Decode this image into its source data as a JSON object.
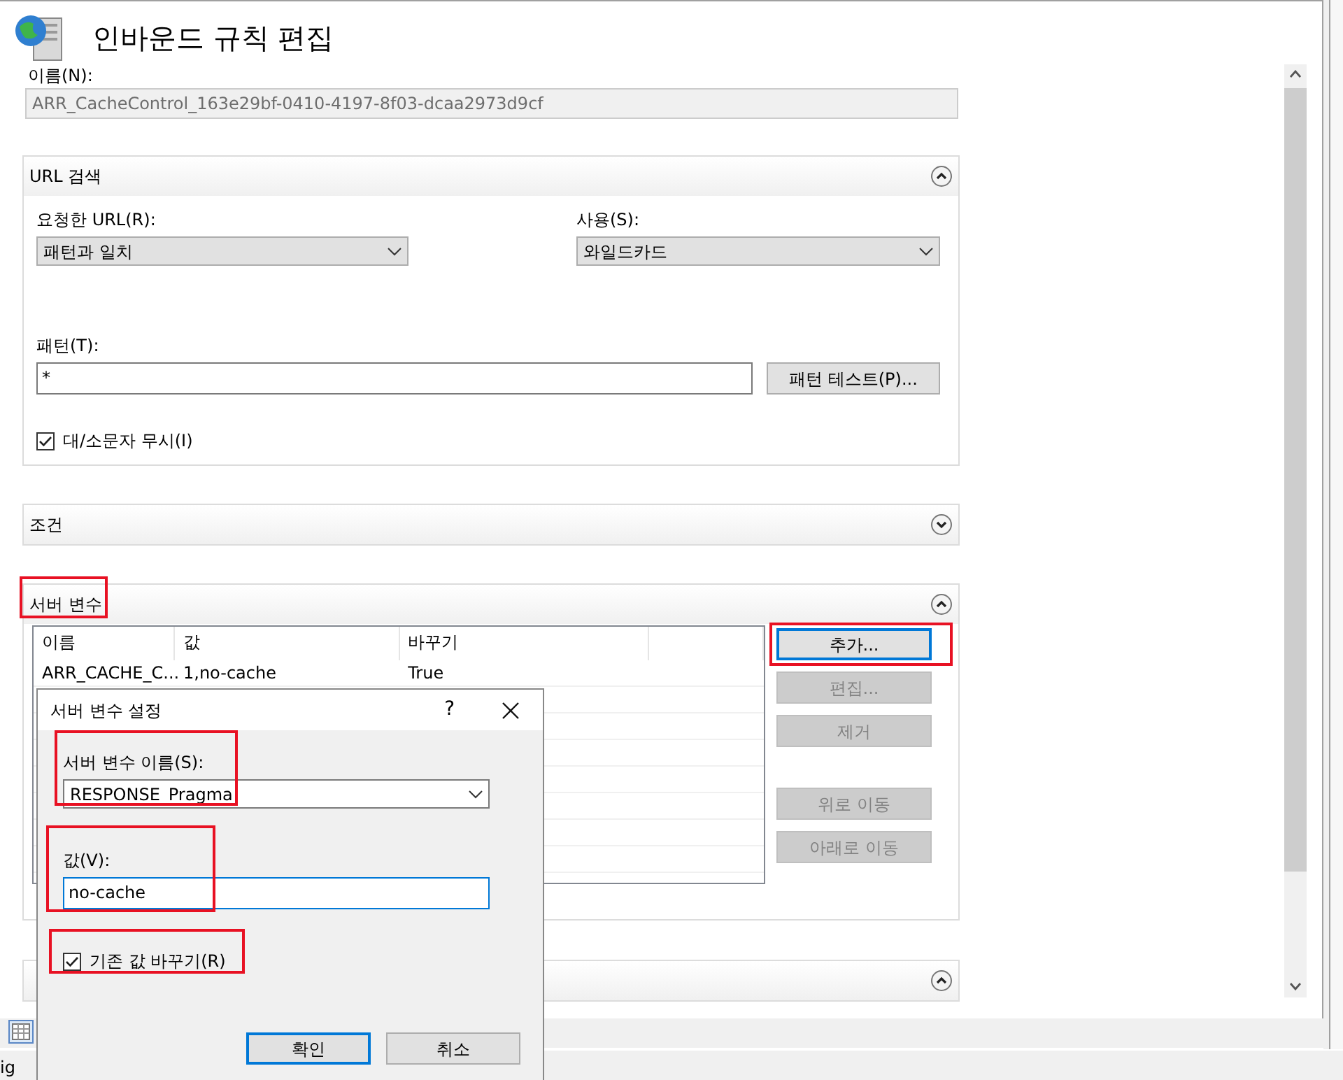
{
  "title": "인바운드 규칙 편집",
  "name_field": {
    "label": "이름(N):",
    "value": "ARR_CacheControl_163e29bf-0410-4197-8f03-dcaa2973d9cf",
    "disabled": true
  },
  "sections": [
    {
      "title": "URL 검색",
      "expanded": true,
      "highlighted": false
    },
    {
      "title": "조건",
      "expanded": false,
      "highlighted": false
    },
    {
      "title": "서버 변수",
      "expanded": true,
      "highlighted": true
    },
    {
      "expanded": true,
      "highlighted": false
    }
  ],
  "url_match": {
    "requested_url": {
      "label": "요청한 URL(R):",
      "value": "패턴과 일치"
    },
    "using": {
      "label": "사용(S):",
      "value": "와일드카드"
    },
    "pattern": {
      "label": "패턴(T):",
      "value": "*"
    },
    "test_button": "패턴 테스트(P)...",
    "ignore_case": {
      "label": "대/소문자 무시(I)",
      "checked": true
    }
  },
  "server_variables": {
    "columns": [
      "이름",
      "값",
      "바꾸기"
    ],
    "rows": [
      {
        "cells": [
          "ARR_CACHE_C...",
          "1,no-cache",
          "True"
        ]
      }
    ],
    "buttons": [
      {
        "label": "추가...",
        "disabled": false,
        "focused": true,
        "highlighted": true
      },
      {
        "label": "편집...",
        "disabled": true,
        "focused": false,
        "highlighted": false
      },
      {
        "label": "제거",
        "disabled": true,
        "focused": false,
        "highlighted": false
      },
      {
        "label": "위로 이동",
        "disabled": true,
        "focused": false,
        "highlighted": false
      },
      {
        "label": "아래로 이동",
        "disabled": true,
        "focused": false,
        "highlighted": false
      }
    ]
  },
  "dialog": {
    "title": "서버 변수 설정",
    "help": "?",
    "name": {
      "label": "서버 변수 이름(S):",
      "value": "RESPONSE_Pragma",
      "highlighted": true
    },
    "value": {
      "label": "값(V):",
      "value": "no-cache",
      "focused": true,
      "highlighted": true
    },
    "replace": {
      "label": "기존 값 바꾸기(R)",
      "checked": true,
      "highlighted": true
    },
    "buttons": [
      {
        "label": "확인",
        "default": true
      },
      {
        "label": "취소",
        "default": false
      }
    ]
  },
  "status_bar": {
    "text": "ig"
  }
}
